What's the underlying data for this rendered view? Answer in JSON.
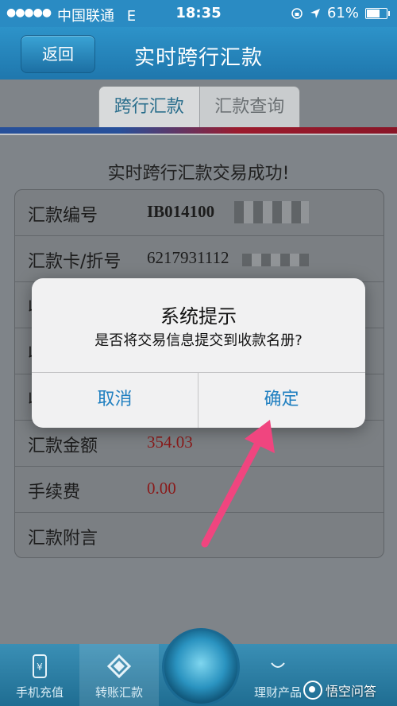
{
  "status_bar": {
    "signal": "●●●●●",
    "carrier": "中国联通",
    "network": "E",
    "time": "18:35",
    "battery": "61%"
  },
  "nav": {
    "back_label": "返回",
    "title": "实时跨行汇款"
  },
  "segments": {
    "active": "跨行汇款",
    "inactive": "汇款查询"
  },
  "result_message": "实时跨行汇款交易成功!",
  "details": [
    {
      "label": "汇款编号",
      "value": "IB014100"
    },
    {
      "label": "汇款卡/折号",
      "value": "6217931112"
    },
    {
      "label": "收",
      "value": ""
    },
    {
      "label": "收",
      "value": ""
    },
    {
      "label": "收",
      "value": ""
    },
    {
      "label": "汇款金额",
      "value": "354.03"
    },
    {
      "label": "手续费",
      "value": "0.00"
    },
    {
      "label": "汇款附言",
      "value": ""
    }
  ],
  "dialog": {
    "title": "系统提示",
    "message": "是否将交易信息提交到收款名册?",
    "cancel_label": "取消",
    "confirm_label": "确定"
  },
  "tabbar": {
    "items": [
      {
        "label": "手机充值"
      },
      {
        "label": "转账汇款"
      },
      {
        "label": ""
      },
      {
        "label": "理财产品"
      },
      {
        "label": ""
      }
    ]
  },
  "watermark": "悟空问答",
  "colors": {
    "nav_blue": "#2a8bc3",
    "dialog_button": "#1f7fc0",
    "amount_red": "#8a1a1a",
    "arrow_pink": "#f0457f"
  }
}
